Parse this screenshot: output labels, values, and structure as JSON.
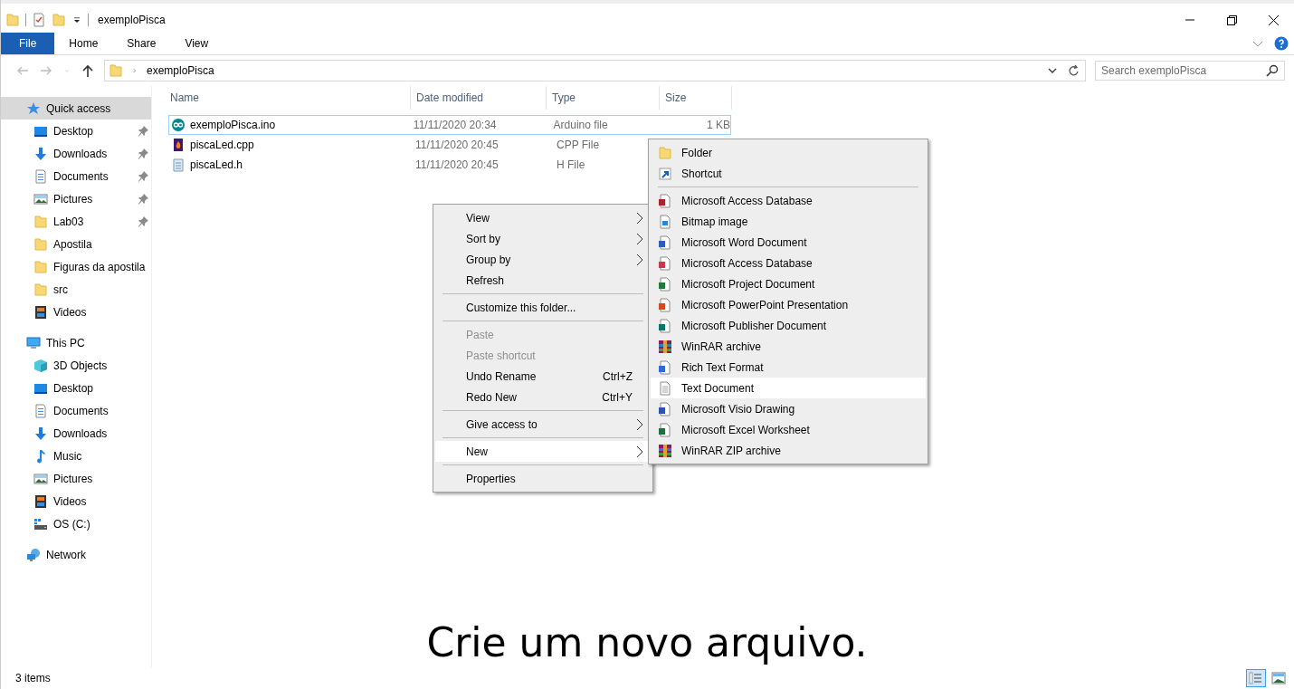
{
  "window": {
    "title": "exemploPisca"
  },
  "ribbon_tabs": [
    {
      "label": "File",
      "selected": true
    },
    {
      "label": "Home",
      "selected": false
    },
    {
      "label": "Share",
      "selected": false
    },
    {
      "label": "View",
      "selected": false
    }
  ],
  "address": {
    "path": "exemploPisca",
    "search_placeholder": "Search exemploPisca"
  },
  "sidebar": [
    {
      "label": "Quick access",
      "kind": "star",
      "selected": true,
      "children": [
        {
          "label": "Desktop",
          "kind": "desktop",
          "pinned": true,
          "selected": false
        },
        {
          "label": "Downloads",
          "kind": "download",
          "pinned": true,
          "selected": false
        },
        {
          "label": "Documents",
          "kind": "documents",
          "pinned": true,
          "selected": false
        },
        {
          "label": "Pictures",
          "kind": "pictures",
          "pinned": true,
          "selected": false
        },
        {
          "label": "Lab03",
          "kind": "folder",
          "pinned": true,
          "selected": false
        },
        {
          "label": "Apostila",
          "kind": "folder",
          "pinned": false,
          "selected": false
        },
        {
          "label": "Figuras da apostila",
          "kind": "folder",
          "pinned": false,
          "selected": false
        },
        {
          "label": "src",
          "kind": "folder",
          "pinned": false,
          "selected": false
        },
        {
          "label": "Videos",
          "kind": "videos",
          "pinned": false,
          "selected": false
        }
      ]
    },
    {
      "label": "This PC",
      "kind": "pc",
      "selected": false,
      "children": [
        {
          "label": "3D Objects",
          "kind": "cube",
          "pinned": false,
          "selected": false
        },
        {
          "label": "Desktop",
          "kind": "desktop",
          "pinned": false,
          "selected": false
        },
        {
          "label": "Documents",
          "kind": "documents",
          "pinned": false,
          "selected": false
        },
        {
          "label": "Downloads",
          "kind": "download",
          "pinned": false,
          "selected": false
        },
        {
          "label": "Music",
          "kind": "music",
          "pinned": false,
          "selected": false
        },
        {
          "label": "Pictures",
          "kind": "pictures",
          "pinned": false,
          "selected": false
        },
        {
          "label": "Videos",
          "kind": "videos",
          "pinned": false,
          "selected": false
        },
        {
          "label": "OS (C:)",
          "kind": "drive",
          "pinned": false,
          "selected": false
        }
      ]
    },
    {
      "label": "Network",
      "kind": "network",
      "selected": false
    }
  ],
  "columns": [
    "Name",
    "Date modified",
    "Type",
    "Size"
  ],
  "files": [
    {
      "name": "exemploPisca.ino",
      "date": "11/11/2020 20:34",
      "type": "Arduino file",
      "size": "1 KB",
      "kind": "arduino",
      "selected": true
    },
    {
      "name": "piscaLed.cpp",
      "date": "11/11/2020 20:45",
      "type": "CPP File",
      "kind": "cpp",
      "selected": false
    },
    {
      "name": "piscaLed.h",
      "date": "11/11/2020 20:45",
      "type": "H File",
      "kind": "header",
      "selected": false
    }
  ],
  "context_menu": [
    {
      "kind": "item",
      "label": "View",
      "submenu": true,
      "disabled": false,
      "selected": false
    },
    {
      "kind": "item",
      "label": "Sort by",
      "submenu": true,
      "disabled": false,
      "selected": false
    },
    {
      "kind": "item",
      "label": "Group by",
      "submenu": true,
      "disabled": false,
      "selected": false
    },
    {
      "kind": "item",
      "label": "Refresh",
      "submenu": false,
      "disabled": false,
      "selected": false
    },
    {
      "kind": "separator"
    },
    {
      "kind": "item",
      "label": "Customize this folder...",
      "submenu": false,
      "disabled": false,
      "selected": false
    },
    {
      "kind": "separator"
    },
    {
      "kind": "item",
      "label": "Paste",
      "submenu": false,
      "disabled": true,
      "selected": false
    },
    {
      "kind": "item",
      "label": "Paste shortcut",
      "submenu": false,
      "disabled": true,
      "selected": false
    },
    {
      "kind": "item",
      "label": "Undo Rename",
      "shortcut": "Ctrl+Z",
      "submenu": false,
      "disabled": false,
      "selected": false
    },
    {
      "kind": "item",
      "label": "Redo New",
      "shortcut": "Ctrl+Y",
      "submenu": false,
      "disabled": false,
      "selected": false
    },
    {
      "kind": "separator"
    },
    {
      "kind": "item",
      "label": "Give access to",
      "submenu": true,
      "disabled": false,
      "selected": false
    },
    {
      "kind": "separator"
    },
    {
      "kind": "item",
      "label": "New",
      "submenu": true,
      "disabled": false,
      "selected": true
    },
    {
      "kind": "separator"
    },
    {
      "kind": "item",
      "label": "Properties",
      "submenu": false,
      "disabled": false,
      "selected": false
    }
  ],
  "new_submenu": [
    {
      "kind": "folder",
      "label": "Folder",
      "selected": false
    },
    {
      "kind": "shortcut",
      "label": "Shortcut",
      "selected": false
    },
    {
      "kind": "separator"
    },
    {
      "kind": "access",
      "label": "Microsoft Access Database",
      "selected": false
    },
    {
      "kind": "bitmap",
      "label": "Bitmap image",
      "selected": false
    },
    {
      "kind": "word",
      "label": "Microsoft Word Document",
      "selected": false
    },
    {
      "kind": "access-alt",
      "label": "Microsoft Access Database",
      "selected": false
    },
    {
      "kind": "project",
      "label": "Microsoft Project Document",
      "selected": false
    },
    {
      "kind": "powerpoint",
      "label": "Microsoft PowerPoint Presentation",
      "selected": false
    },
    {
      "kind": "publisher",
      "label": "Microsoft Publisher Document",
      "selected": false
    },
    {
      "kind": "winrar",
      "label": "WinRAR archive",
      "selected": false
    },
    {
      "kind": "rtf",
      "label": "Rich Text Format",
      "selected": false
    },
    {
      "kind": "text",
      "label": "Text Document",
      "selected": true
    },
    {
      "kind": "visio",
      "label": "Microsoft Visio Drawing",
      "selected": false
    },
    {
      "kind": "excel",
      "label": "Microsoft Excel Worksheet",
      "selected": false
    },
    {
      "kind": "winrar",
      "label": "WinRAR ZIP archive",
      "selected": false
    }
  ],
  "status_bar": {
    "items": "3 items",
    "views": [
      {
        "kind": "details",
        "selected": true
      },
      {
        "kind": "large-icons",
        "selected": false
      }
    ]
  },
  "caption": "Crie um novo arquivo."
}
